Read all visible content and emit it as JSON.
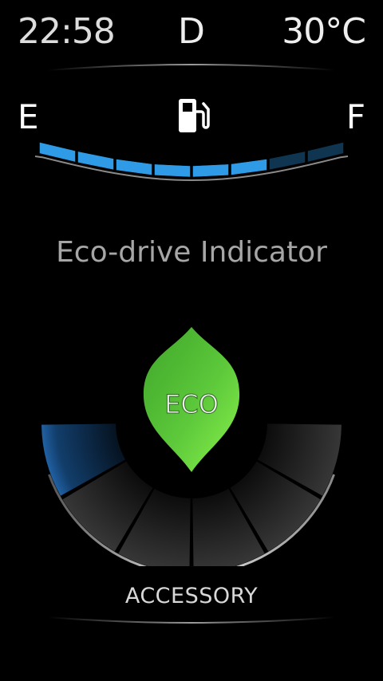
{
  "status": {
    "time": "22:58",
    "gear": "D",
    "temperature": "30°C"
  },
  "fuel": {
    "empty_label": "E",
    "full_label": "F",
    "icon": "fuel-pump-icon",
    "total_segments": 8,
    "filled_segments": 6,
    "fill_color": "#2f9be6",
    "empty_color": "#0f3550"
  },
  "eco": {
    "title": "Eco-drive Indicator",
    "badge_label": "ECO",
    "badge_color": "#52c234",
    "icon": "leaf-icon",
    "total_segments": 6,
    "active_segments": 1,
    "active_color": "#2a78c8"
  },
  "mode": {
    "label": "ACCESSORY"
  }
}
